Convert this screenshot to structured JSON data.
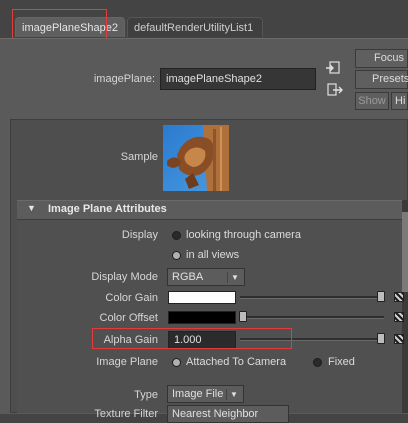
{
  "tabs": [
    {
      "label": "imagePlaneShape2",
      "active": true
    },
    {
      "label": "defaultRenderUtilityList1",
      "active": false
    }
  ],
  "header": {
    "node_label": "imagePlane:",
    "node_value": "imagePlaneShape2",
    "buttons": {
      "focus": "Focus",
      "presets": "Presets",
      "show": "Show",
      "hide": "Hi"
    },
    "sample_label": "Sample"
  },
  "section": {
    "title": "Image Plane Attributes",
    "arrow": "▼"
  },
  "attributes": {
    "display": {
      "label": "Display",
      "options": [
        "looking through camera",
        "in all views"
      ],
      "selected": 1
    },
    "display_mode": {
      "label": "Display Mode",
      "value": "RGBA"
    },
    "color_gain": {
      "label": "Color Gain",
      "color": "#ffffff",
      "slider_level": 1.0
    },
    "color_offset": {
      "label": "Color Offset",
      "color": "#000000",
      "slider_level": 0.0
    },
    "alpha_gain": {
      "label": "Alpha Gain",
      "value": "1.000",
      "slider_level": 1.0
    },
    "image_plane": {
      "label": "Image Plane",
      "options": [
        "Attached To Camera",
        "Fixed"
      ],
      "selected": 0
    },
    "type": {
      "label": "Type",
      "value": "Image File"
    },
    "texture_filter": {
      "label": "Texture Filter",
      "value": "Nearest Neighbor"
    }
  }
}
